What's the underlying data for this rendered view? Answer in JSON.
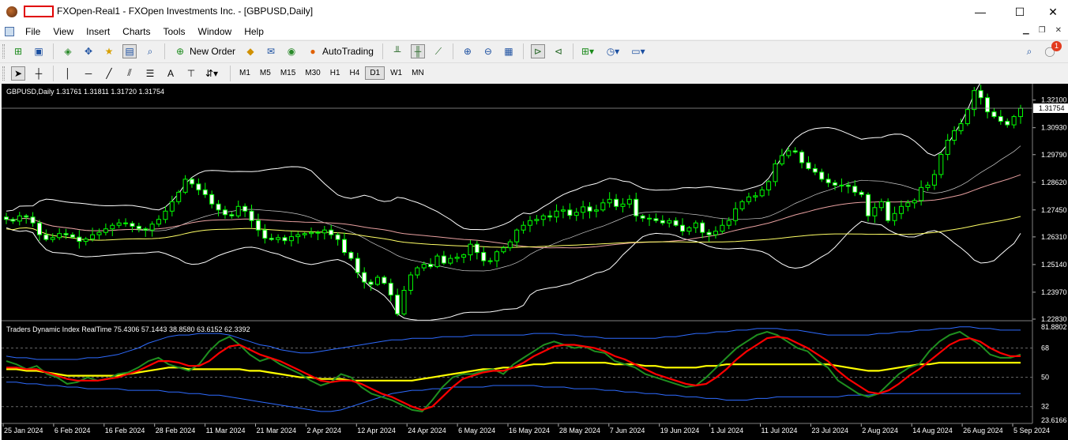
{
  "window": {
    "title": "FXOpen-Real1 - FXOpen Investments Inc. - [GBPUSD,Daily]",
    "minimize_glyph": "—",
    "maximize_glyph": "☐",
    "close_glyph": "✕"
  },
  "menu": {
    "items": [
      "File",
      "View",
      "Insert",
      "Charts",
      "Tools",
      "Window",
      "Help"
    ]
  },
  "toolbar": {
    "new_order_label": "New Order",
    "autotrading_label": "AutoTrading",
    "notification_count": "1",
    "icons": [
      "new-chart-icon",
      "profiles-icon",
      "market-watch-icon",
      "navigator-icon",
      "favorites-icon",
      "data-window-icon",
      "strategy-tester-icon",
      "metaeditor-icon",
      "mailbox-icon",
      "signals-icon",
      "bar-chart-icon",
      "candlestick-icon",
      "line-chart-icon",
      "zoom-in-icon",
      "zoom-out-icon",
      "tile-windows-icon",
      "chart-shift-icon",
      "autoscroll-icon",
      "indicators-icon",
      "periods-icon",
      "templates-icon",
      "search-icon",
      "notifications-icon"
    ]
  },
  "timeframes": {
    "items": [
      "M1",
      "M5",
      "M15",
      "M30",
      "H1",
      "H4",
      "D1",
      "W1",
      "MN"
    ],
    "active": "D1"
  },
  "chart": {
    "header": "GBPUSD,Daily  1.31761 1.31811 1.31720 1.31754",
    "price_axis": [
      "1.32100",
      "1.30930",
      "1.29790",
      "1.28620",
      "1.27450",
      "1.26310",
      "1.25140",
      "1.23970",
      "1.22830"
    ],
    "current_price": "1.31754",
    "indicator_header": "Traders Dynamic Index RealTime 75.4306 57.1443 38.8580 63.6152 62.3392",
    "indicator_axis": [
      "81.8802",
      "68",
      "50",
      "32",
      "23.6166"
    ],
    "time_axis": [
      "25 Jan 2024",
      "6 Feb 2024",
      "16 Feb 2024",
      "28 Feb 2024",
      "11 Mar 2024",
      "21 Mar 2024",
      "2 Apr 2024",
      "12 Apr 2024",
      "24 Apr 2024",
      "6 May 2024",
      "16 May 2024",
      "28 May 2024",
      "7 Jun 2024",
      "19 Jun 2024",
      "1 Jul 2024",
      "11 Jul 2024",
      "23 Jul 2024",
      "2 Aug 2024",
      "14 Aug 2024",
      "26 Aug 2024",
      "5 Sep 2024"
    ],
    "colors": {
      "background": "#000000",
      "candle": "#00ff00",
      "bollinger": "#ffffff",
      "ma_slow": "#ffff66",
      "ma_mid": "#e8a0a0",
      "tdi_band": "#2e6bff",
      "tdi_base": "#ffff00",
      "tdi_signal": "#ff0000",
      "tdi_rsi": "#1f8f1f"
    }
  },
  "chart_data": {
    "type": "candlestick",
    "symbol": "GBPUSD",
    "timeframe": "Daily",
    "ylim": [
      1.2283,
      1.3269
    ],
    "close_path": [
      1.2705,
      1.2698,
      1.272,
      1.2715,
      1.269,
      1.264,
      1.262,
      1.2628,
      1.2645,
      1.264,
      1.263,
      1.2612,
      1.2622,
      1.264,
      1.265,
      1.2665,
      1.268,
      1.269,
      1.2688,
      1.2676,
      1.2665,
      1.266,
      1.2685,
      1.2705,
      1.274,
      1.278,
      1.282,
      1.2875,
      1.2855,
      1.283,
      1.281,
      1.277,
      1.2745,
      1.2725,
      1.272,
      1.276,
      1.274,
      1.27,
      1.266,
      1.2625,
      1.262,
      1.2628,
      1.2615,
      1.2632,
      1.264,
      1.2645,
      1.265,
      1.2648,
      1.266,
      1.264,
      1.262,
      1.2565,
      1.254,
      1.248,
      1.244,
      1.243,
      1.246,
      1.2435,
      1.2385,
      1.2305,
      1.2405,
      1.247,
      1.25,
      1.2515,
      1.2505,
      1.255,
      1.252,
      1.254,
      1.2545,
      1.2555,
      1.26,
      1.2565,
      1.253,
      1.253,
      1.2568,
      1.2585,
      1.261,
      1.266,
      1.268,
      1.27,
      1.2705,
      1.272,
      1.2715,
      1.274,
      1.2745,
      1.2722,
      1.2735,
      1.2758,
      1.274,
      1.2745,
      1.2775,
      1.279,
      1.276,
      1.277,
      1.279,
      1.272,
      1.271,
      1.2708,
      1.27,
      1.269,
      1.27,
      1.268,
      1.2655,
      1.267,
      1.269,
      1.265,
      1.264,
      1.2655,
      1.268,
      1.27,
      1.275,
      1.278,
      1.28,
      1.2805,
      1.283,
      1.2865,
      1.294,
      1.2975,
      1.2995,
      1.299,
      1.2945,
      1.292,
      1.2905,
      1.2875,
      1.286,
      1.285,
      1.285,
      1.2845,
      1.282,
      1.281,
      1.272,
      1.2755,
      1.278,
      1.27,
      1.273,
      1.276,
      1.2775,
      1.2785,
      1.284,
      1.285,
      1.2895,
      1.298,
      1.304,
      1.308,
      1.311,
      1.317,
      1.325,
      1.322,
      1.316,
      1.314,
      1.312,
      1.3105,
      1.314,
      1.3175
    ]
  },
  "tdi_data": {
    "ylim": [
      23.6166,
      81.8802
    ],
    "levels": [
      68,
      50,
      32
    ],
    "rsi": [
      60,
      58,
      55,
      57,
      52,
      50,
      46,
      47,
      50,
      48,
      49,
      52,
      53,
      56,
      60,
      62,
      58,
      56,
      54,
      58,
      66,
      72,
      75,
      70,
      64,
      60,
      62,
      58,
      55,
      52,
      48,
      45,
      47,
      52,
      50,
      44,
      40,
      38,
      36,
      33,
      30,
      29,
      36,
      44,
      50,
      52,
      52,
      54,
      55,
      52,
      58,
      62,
      66,
      70,
      72,
      70,
      68,
      69,
      66,
      65,
      60,
      58,
      56,
      52,
      50,
      48,
      46,
      44,
      45,
      50,
      56,
      62,
      68,
      72,
      76,
      78,
      76,
      72,
      68,
      66,
      60,
      56,
      48,
      44,
      40,
      38,
      40,
      46,
      52,
      56,
      58,
      66,
      72,
      76,
      78,
      74,
      70,
      64,
      62,
      62,
      64
    ],
    "signal": [
      56,
      56,
      55,
      55,
      53,
      51,
      49,
      48,
      48,
      48,
      49,
      50,
      52,
      54,
      57,
      60,
      60,
      59,
      57,
      57,
      60,
      65,
      69,
      70,
      67,
      64,
      62,
      60,
      57,
      54,
      51,
      48,
      47,
      48,
      48,
      46,
      43,
      40,
      38,
      35,
      32,
      30,
      32,
      38,
      44,
      49,
      51,
      53,
      54,
      54,
      56,
      59,
      63,
      66,
      69,
      70,
      70,
      69,
      68,
      66,
      63,
      61,
      58,
      55,
      52,
      50,
      48,
      46,
      45,
      46,
      50,
      55,
      61,
      66,
      70,
      74,
      75,
      74,
      71,
      68,
      64,
      60,
      54,
      49,
      45,
      41,
      40,
      42,
      46,
      51,
      55,
      60,
      65,
      70,
      73,
      74,
      72,
      68,
      65,
      63,
      63
    ],
    "base": [
      55,
      55,
      54,
      54,
      53,
      52,
      51,
      51,
      51,
      51,
      51,
      51,
      52,
      53,
      54,
      55,
      56,
      56,
      55,
      55,
      55,
      55,
      55,
      55,
      54,
      54,
      53,
      52,
      51,
      50,
      50,
      49,
      49,
      49,
      48,
      48,
      48,
      48,
      48,
      48,
      48,
      49,
      50,
      51,
      52,
      53,
      54,
      55,
      55,
      56,
      56,
      57,
      58,
      58,
      59,
      59,
      59,
      59,
      59,
      59,
      58,
      58,
      58,
      57,
      57,
      56,
      56,
      56,
      56,
      57,
      57,
      58,
      58,
      58,
      58,
      58,
      58,
      58,
      58,
      58,
      58,
      58,
      57,
      56,
      55,
      54,
      54,
      55,
      56,
      57,
      58,
      58,
      59,
      59,
      59,
      59,
      59,
      59,
      59,
      59,
      59
    ],
    "upper": [
      63,
      62,
      62,
      61,
      61,
      61,
      61,
      61,
      62,
      62,
      63,
      64,
      66,
      68,
      71,
      73,
      75,
      76,
      76,
      77,
      77,
      77,
      76,
      74,
      72,
      70,
      69,
      67,
      66,
      65,
      65,
      66,
      67,
      68,
      69,
      70,
      71,
      72,
      73,
      73,
      74,
      74,
      74,
      75,
      75,
      75,
      76,
      76,
      76,
      76,
      76,
      76,
      77,
      77,
      77,
      76,
      76,
      75,
      75,
      74,
      74,
      74,
      74,
      74,
      74,
      75,
      75,
      76,
      77,
      77,
      78,
      78,
      79,
      79,
      80,
      80,
      80,
      79,
      79,
      78,
      77,
      76,
      76,
      76,
      76,
      76,
      77,
      77,
      78,
      78,
      79,
      79,
      80,
      80,
      81,
      81,
      80,
      80,
      79,
      79,
      79
    ],
    "lower": [
      47,
      47,
      46,
      46,
      45,
      45,
      44,
      44,
      43,
      43,
      43,
      43,
      42,
      42,
      42,
      42,
      41,
      41,
      40,
      40,
      39,
      39,
      38,
      37,
      36,
      35,
      34,
      33,
      32,
      31,
      30,
      29,
      29,
      30,
      32,
      34,
      36,
      38,
      40,
      41,
      42,
      42,
      43,
      43,
      44,
      44,
      44,
      44,
      45,
      45,
      45,
      45,
      45,
      44,
      44,
      44,
      43,
      43,
      43,
      42,
      42,
      41,
      41,
      40,
      40,
      39,
      39,
      38,
      38,
      37,
      37,
      36,
      36,
      36,
      37,
      37,
      38,
      38,
      38,
      38,
      38,
      38,
      38,
      39,
      39,
      39,
      40,
      40,
      40,
      40,
      40,
      40,
      40,
      40,
      40,
      40,
      40,
      40,
      40,
      40,
      40
    ]
  }
}
